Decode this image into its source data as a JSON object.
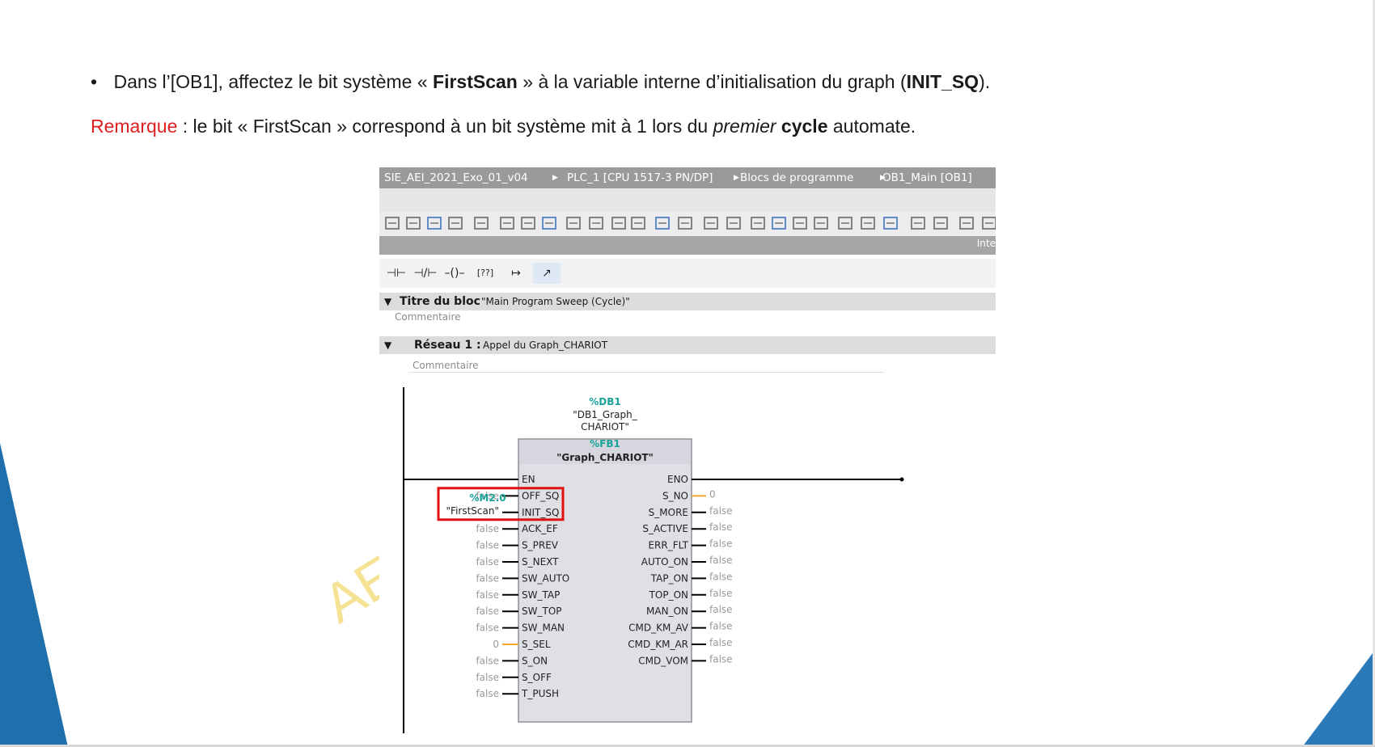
{
  "slide": {
    "bullet": "•",
    "line1": {
      "part1": "Dans l’[OB1], affectez le bit système « ",
      "bold1": "FirstScan",
      "part2": " » à la variable interne d’initialisation du graph (",
      "bold2": "INIT_SQ",
      "part3": ")."
    },
    "line2": {
      "label": "Remarque",
      "part1": " : le bit « FirstScan » correspond à un bit système mit à 1 lors du ",
      "italic": "premier",
      "bold": " cycle",
      "part2": " automate."
    },
    "watermark": "AE",
    "colors": {
      "accent_blue": "#1f6fad",
      "remark_red": "#e02020",
      "highlight_box": "#e01010",
      "address_teal": "#1aa39a"
    }
  },
  "editor": {
    "breadcrumb": [
      "SIE_AEI_2021_Exo_01_v04",
      "PLC_1 [CPU 1517-3 PN/DP]",
      "Blocs de programme",
      "OB1_Main [OB1]"
    ],
    "right_label": "Inte",
    "ladder_tools": [
      "⊣⊢",
      "⊣/⊢",
      "–()–",
      "[??]",
      "↦",
      "↗"
    ],
    "block_title_label": "Titre du bloc",
    "block_title_value": "\"Main Program Sweep (Cycle)\"",
    "comment": "Commentaire",
    "network_label": "Réseau 1 :",
    "network_title": "Appel du Graph_CHARIOT",
    "network_comment": "Commentaire"
  },
  "fb": {
    "db_address": "%DB1",
    "db_name_line1": "\"DB1_Graph_",
    "db_name_line2": "CHARIOT\"",
    "fb_address": "%FB1",
    "fb_name": "\"Graph_CHARIOT\"",
    "inputs": [
      {
        "pin": "EN",
        "value": ""
      },
      {
        "pin": "OFF_SQ",
        "value": "false"
      },
      {
        "pin": "INIT_SQ",
        "value": "\"FirstScan\"",
        "address": "%M2.0"
      },
      {
        "pin": "ACK_EF",
        "value": "false"
      },
      {
        "pin": "S_PREV",
        "value": "false"
      },
      {
        "pin": "S_NEXT",
        "value": "false"
      },
      {
        "pin": "SW_AUTO",
        "value": "false"
      },
      {
        "pin": "SW_TAP",
        "value": "false"
      },
      {
        "pin": "SW_TOP",
        "value": "false"
      },
      {
        "pin": "SW_MAN",
        "value": "false"
      },
      {
        "pin": "S_SEL",
        "value": "0"
      },
      {
        "pin": "S_ON",
        "value": "false"
      },
      {
        "pin": "S_OFF",
        "value": "false"
      },
      {
        "pin": "T_PUSH",
        "value": "false"
      }
    ],
    "outputs": [
      {
        "pin": "ENO",
        "value": ""
      },
      {
        "pin": "S_NO",
        "value": "0"
      },
      {
        "pin": "S_MORE",
        "value": "false"
      },
      {
        "pin": "S_ACTIVE",
        "value": "false"
      },
      {
        "pin": "ERR_FLT",
        "value": "false"
      },
      {
        "pin": "AUTO_ON",
        "value": "false"
      },
      {
        "pin": "TAP_ON",
        "value": "false"
      },
      {
        "pin": "TOP_ON",
        "value": "false"
      },
      {
        "pin": "MAN_ON",
        "value": "false"
      },
      {
        "pin": "CMD_KM_AV",
        "value": "false"
      },
      {
        "pin": "CMD_KM_AR",
        "value": "false"
      },
      {
        "pin": "CMD_VOM",
        "value": "false"
      }
    ]
  }
}
